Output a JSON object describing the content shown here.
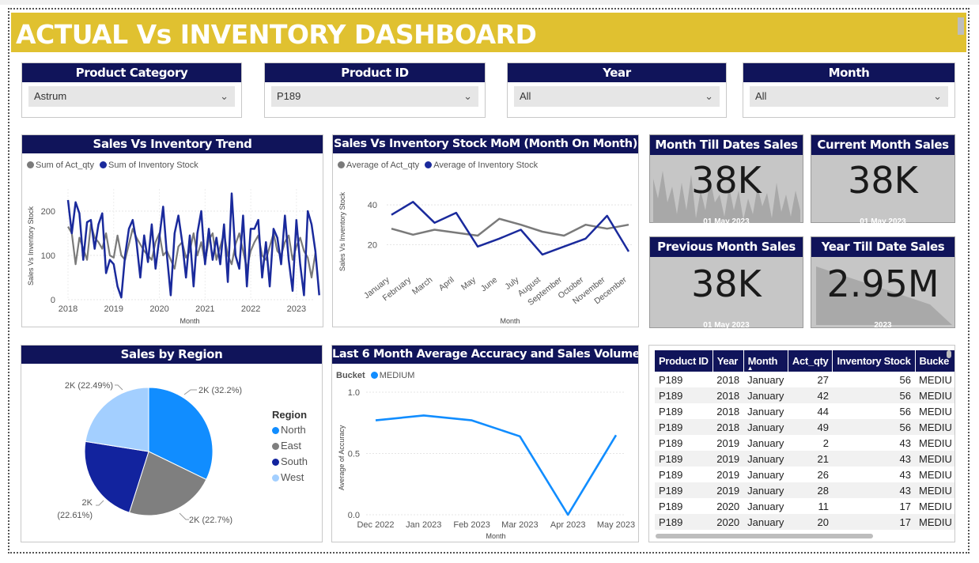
{
  "title": "ACTUAL Vs INVENTORY DASHBOARD",
  "slicers": [
    {
      "label": "Product Category",
      "value": "Astrum"
    },
    {
      "label": "Product ID",
      "value": "P189"
    },
    {
      "label": "Year",
      "value": "All"
    },
    {
      "label": "Month",
      "value": "All"
    }
  ],
  "trend": {
    "title": "Sales Vs Inventory Trend",
    "legend": [
      "Sum of Act_qty",
      "Sum of Inventory Stock"
    ],
    "ylabel": "Sales Vs Inventory Stock",
    "xlabel": "Month",
    "yticks": [
      "200",
      "100",
      "0"
    ],
    "xticks": [
      "2018",
      "2019",
      "2020",
      "2021",
      "2022",
      "2023"
    ]
  },
  "mom": {
    "title": "Sales Vs Inventory Stock MoM (Month On Month)",
    "legend": [
      "Average of Act_qty",
      "Average of Inventory Stock"
    ],
    "ylabel": "Sales Vs Inventory Stock",
    "xlabel": "Month",
    "yticks": [
      "40",
      "20"
    ],
    "months": [
      "January",
      "February",
      "March",
      "April",
      "May",
      "June",
      "July",
      "August",
      "September",
      "October",
      "November",
      "December"
    ]
  },
  "kpis": [
    {
      "title": "Month Till Dates Sales",
      "value": "38K",
      "sub": "01 May 2023"
    },
    {
      "title": "Current Month Sales",
      "value": "38K",
      "sub": "01 May 2023"
    },
    {
      "title": "Previous Month Sales",
      "value": "38K",
      "sub": "01 May 2023"
    },
    {
      "title": "Year Till Date Sales",
      "value": "2.95M",
      "sub": "2023"
    }
  ],
  "region": {
    "title": "Sales by Region",
    "legend_title": "Region",
    "labels": [
      "2K (32.2%)",
      "2K (22.7%)",
      "2K",
      "(22.61%)",
      "2K (22.49%)"
    ],
    "legend": [
      "North",
      "East",
      "South",
      "West"
    ]
  },
  "accuracy": {
    "title": "Last 6 Month Average Accuracy and Sales Volume",
    "legend_title": "Bucket",
    "legend": "MEDIUM",
    "ylabel": "Average of Accuracy",
    "xlabel": "Month",
    "yticks": [
      "1.0",
      "0.5",
      "0.0"
    ],
    "xticks": [
      "Dec 2022",
      "Jan 2023",
      "Feb 2023",
      "Mar 2023",
      "Apr 2023",
      "May 2023"
    ]
  },
  "table": {
    "headers": [
      "Product ID",
      "Year",
      "Month",
      "Act_qty",
      "Inventory Stock",
      "Bucke"
    ],
    "rows": [
      [
        "P189",
        "2018",
        "January",
        "27",
        "56",
        "MEDIU"
      ],
      [
        "P189",
        "2018",
        "January",
        "42",
        "56",
        "MEDIU"
      ],
      [
        "P189",
        "2018",
        "January",
        "44",
        "56",
        "MEDIU"
      ],
      [
        "P189",
        "2018",
        "January",
        "49",
        "56",
        "MEDIU"
      ],
      [
        "P189",
        "2019",
        "January",
        "2",
        "43",
        "MEDIU"
      ],
      [
        "P189",
        "2019",
        "January",
        "21",
        "43",
        "MEDIU"
      ],
      [
        "P189",
        "2019",
        "January",
        "26",
        "43",
        "MEDIU"
      ],
      [
        "P189",
        "2019",
        "January",
        "28",
        "43",
        "MEDIU"
      ],
      [
        "P189",
        "2020",
        "January",
        "11",
        "17",
        "MEDIU"
      ],
      [
        "P189",
        "2020",
        "January",
        "20",
        "17",
        "MEDIU"
      ]
    ]
  },
  "colors": {
    "navy": "#10145a",
    "gold": "#e0c130",
    "gray_series": "#7a7a7a",
    "blue_series": "#1a2a9c",
    "north": "#118dff",
    "east": "#7f7f7f",
    "south": "#12239e",
    "west": "#a3cfff",
    "medium": "#118dff"
  },
  "chart_data": [
    {
      "type": "line",
      "title": "Sales Vs Inventory Trend",
      "xlabel": "Month",
      "ylabel": "Sales Vs Inventory Stock",
      "ylim": [
        0,
        250
      ],
      "xlim": [
        2018,
        2023.4
      ],
      "series": [
        {
          "name": "Sum of Act_qty",
          "x_start": 2018,
          "x_step": 0.0833,
          "values": [
            165,
            150,
            80,
            140,
            115,
            90,
            170,
            140,
            130,
            115,
            150,
            100,
            95,
            145,
            100,
            90,
            125,
            160,
            140,
            125,
            110,
            100,
            90,
            130,
            150,
            100,
            110,
            90,
            70,
            120,
            130,
            95,
            110,
            150,
            100,
            130,
            85,
            135,
            150,
            90,
            120,
            150,
            100,
            80,
            125,
            150,
            110,
            70,
            110,
            130,
            145,
            100,
            90,
            120,
            150,
            110,
            100,
            130,
            145,
            90,
            120,
            140,
            110,
            95,
            50,
            105
          ]
        },
        {
          "name": "Sum of Inventory Stock",
          "x_start": 2018,
          "x_step": 0.0833,
          "values": [
            225,
            150,
            220,
            195,
            90,
            175,
            180,
            115,
            170,
            195,
            60,
            90,
            80,
            30,
            5,
            100,
            160,
            180,
            130,
            50,
            145,
            85,
            170,
            70,
            140,
            210,
            100,
            10,
            150,
            190,
            130,
            50,
            145,
            30,
            150,
            200,
            80,
            160,
            90,
            140,
            80,
            170,
            40,
            240,
            100,
            70,
            190,
            30,
            160,
            160,
            180,
            50,
            130,
            30,
            160,
            140,
            80,
            190,
            90,
            20,
            180,
            80,
            10,
            200,
            170,
            110,
            10
          ]
        }
      ]
    },
    {
      "type": "line",
      "title": "Sales Vs Inventory Stock MoM (Month On Month)",
      "xlabel": "Month",
      "ylabel": "Sales Vs Inventory Stock",
      "categories": [
        "January",
        "February",
        "March",
        "April",
        "May",
        "June",
        "July",
        "August",
        "September",
        "October",
        "November",
        "December"
      ],
      "ylim": [
        5,
        48
      ],
      "series": [
        {
          "name": "Average of Act_qty",
          "values": [
            28,
            25,
            27.5,
            26,
            24.5,
            33,
            30,
            26.5,
            24.5,
            30,
            28,
            30
          ]
        },
        {
          "name": "Average of Inventory Stock",
          "values": [
            35,
            41.5,
            31,
            36,
            19,
            23,
            27.5,
            15,
            19,
            23,
            34.5,
            16.5
          ]
        }
      ]
    },
    {
      "type": "pie",
      "title": "Sales by Region",
      "categories": [
        "North",
        "East",
        "South",
        "West"
      ],
      "values": [
        32.2,
        22.7,
        22.61,
        22.49
      ]
    },
    {
      "type": "line",
      "title": "Last 6 Month Average Accuracy and Sales Volume",
      "xlabel": "Month",
      "ylabel": "Average of Accuracy",
      "categories": [
        "Dec 2022",
        "Jan 2023",
        "Feb 2023",
        "Mar 2023",
        "Apr 2023",
        "May 2023"
      ],
      "ylim": [
        0,
        1
      ],
      "series": [
        {
          "name": "MEDIUM",
          "values": [
            0.77,
            0.81,
            0.77,
            0.64,
            0.0,
            0.65
          ]
        }
      ]
    }
  ]
}
